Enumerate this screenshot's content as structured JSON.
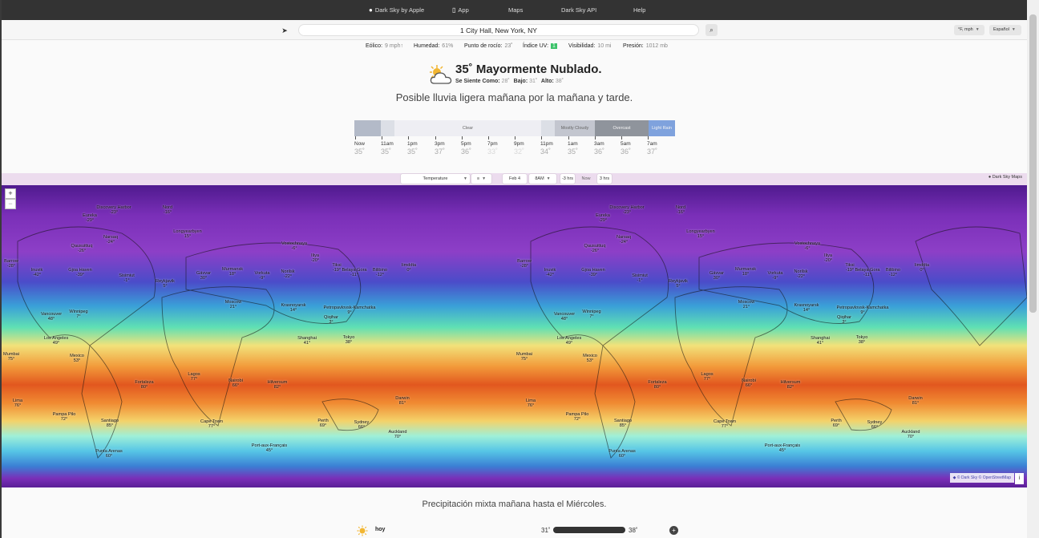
{
  "nav": {
    "brand": "Dark Sky by Apple",
    "app": "App",
    "maps": "Maps",
    "api": "Dark Sky API",
    "help": "Help"
  },
  "search": {
    "location": "1 City Hall, New York, NY",
    "units": "°F, mph",
    "language": "Español"
  },
  "stats": [
    {
      "label": "Eólico:",
      "value": "9 mph↑"
    },
    {
      "label": "Humedad:",
      "value": "61%"
    },
    {
      "label": "Punto de rocío:",
      "value": "23˚"
    },
    {
      "label": "Índice UV:",
      "value": "1"
    },
    {
      "label": "Visibilidad:",
      "value": "10 mi"
    },
    {
      "label": "Presión:",
      "value": "1012 mb"
    }
  ],
  "current": {
    "title": "35˚ Mayormente Nublado.",
    "feels_label": "Se Siente Como:",
    "feels_value": "28˚",
    "low_label": "Bajo:",
    "low_value": "31˚",
    "high_label": "Alto:",
    "high_value": "38˚",
    "headline": "Posible lluvia ligera mañana por la mañana y tarde."
  },
  "timeline": {
    "segments": [
      {
        "label": "",
        "fraction": 0.083,
        "color": "#b3bac8"
      },
      {
        "label": "",
        "fraction": 0.042,
        "color": "#dcdfe6"
      },
      {
        "label": "Clear",
        "fraction": 0.458,
        "color": "#eeeef3"
      },
      {
        "label": "",
        "fraction": 0.042,
        "color": "#dcdfe6"
      },
      {
        "label": "Mostly Cloudy",
        "fraction": 0.125,
        "color": "#c3c6cf"
      },
      {
        "label": "Overcast",
        "fraction": 0.167,
        "color": "#8f949c"
      },
      {
        "label": "Light Rain",
        "fraction": 0.083,
        "color": "#7fa2dd"
      }
    ],
    "hours": [
      {
        "time": "Now",
        "temp": "35˚"
      },
      {
        "time": "11am",
        "temp": "35˚"
      },
      {
        "time": "1pm",
        "temp": "35˚"
      },
      {
        "time": "3pm",
        "temp": "37˚"
      },
      {
        "time": "5pm",
        "temp": "36˚"
      },
      {
        "time": "7pm",
        "temp": "33˚"
      },
      {
        "time": "9pm",
        "temp": "32˚"
      },
      {
        "time": "11pm",
        "temp": "34˚"
      },
      {
        "time": "1am",
        "temp": "35˚"
      },
      {
        "time": "3am",
        "temp": "36˚"
      },
      {
        "time": "5am",
        "temp": "36˚"
      },
      {
        "time": "7am",
        "temp": "37˚"
      }
    ]
  },
  "map": {
    "layer": "Temperature",
    "date": "Feb 4",
    "time": "8AM",
    "minus": "-3 hrs",
    "now": "Now",
    "plus": "3 hrs",
    "brand": "Dark Sky Maps",
    "zoom_in": "+",
    "zoom_out": "−",
    "credit": "© Dark Sky © OpenStreetMap",
    "info": "i",
    "cities": [
      {
        "name": "Discovery Harbor",
        "temp": "-23°"
      },
      {
        "name": "Nord",
        "temp": "-16°"
      },
      {
        "name": "Eureka",
        "temp": "-29°"
      },
      {
        "name": "Narsaq",
        "temp": "-24°"
      },
      {
        "name": "Longyearbyen",
        "temp": "15°"
      },
      {
        "name": "Qausuittuq",
        "temp": "-26°"
      },
      {
        "name": "Vostochnaya",
        "temp": "-6°"
      },
      {
        "name": "Barrow",
        "temp": "-28°"
      },
      {
        "name": "Inuvik",
        "temp": "-42°"
      },
      {
        "name": "Gjoa Haven",
        "temp": "-39°"
      },
      {
        "name": "Sisimiut",
        "temp": "-1°"
      },
      {
        "name": "Reykjavik",
        "temp": "5°"
      },
      {
        "name": "Gávvar",
        "temp": "30°"
      },
      {
        "name": "Murmansk",
        "temp": "18°"
      },
      {
        "name": "Vorkuta",
        "temp": "-9°"
      },
      {
        "name": "Norilsk",
        "temp": "-22°"
      },
      {
        "name": "Iliya",
        "temp": "-20°"
      },
      {
        "name": "Tiksi",
        "temp": "-19°"
      },
      {
        "name": "Belaya Gora",
        "temp": "-11°"
      },
      {
        "name": "Bilibino",
        "temp": "-12°"
      },
      {
        "name": "Iimddta",
        "temp": "0°"
      },
      {
        "name": "Vancouver",
        "temp": "48°"
      },
      {
        "name": "Winnipeg",
        "temp": "7°"
      },
      {
        "name": "Moscow",
        "temp": "21°"
      },
      {
        "name": "Krasnoyarsk",
        "temp": "14°"
      },
      {
        "name": "Petropavlovsk-Kamchatka",
        "temp": "9°"
      },
      {
        "name": "Qiqihar",
        "temp": "3°"
      },
      {
        "name": "Los Angeles",
        "temp": "49°"
      },
      {
        "name": "Mexico",
        "temp": "53°"
      },
      {
        "name": "Mumbai",
        "temp": "75°"
      },
      {
        "name": "Shanghai",
        "temp": "41°"
      },
      {
        "name": "Tokyo",
        "temp": "38°"
      },
      {
        "name": "Lagos",
        "temp": "77°"
      },
      {
        "name": "Nairobi",
        "temp": "66°"
      },
      {
        "name": "Fortaleza",
        "temp": "80°"
      },
      {
        "name": "Hilversum",
        "temp": "82°"
      },
      {
        "name": "Darwin",
        "temp": "81°"
      },
      {
        "name": "Lima",
        "temp": "76°"
      },
      {
        "name": "Pampa Pilo",
        "temp": "72°"
      },
      {
        "name": "Santiago",
        "temp": "85°"
      },
      {
        "name": "Cape Town",
        "temp": "77°"
      },
      {
        "name": "Perth",
        "temp": "69°"
      },
      {
        "name": "Sydney",
        "temp": "66°"
      },
      {
        "name": "Auckland",
        "temp": "70°"
      },
      {
        "name": "Punta Arenas",
        "temp": "60°"
      },
      {
        "name": "Port-aux-Français",
        "temp": "45°"
      }
    ]
  },
  "week": {
    "summary": "Precipitación mixta mañana hasta el Miércoles.",
    "days": [
      {
        "label": "hoy",
        "low": "31˚",
        "high": "38˚"
      }
    ]
  }
}
